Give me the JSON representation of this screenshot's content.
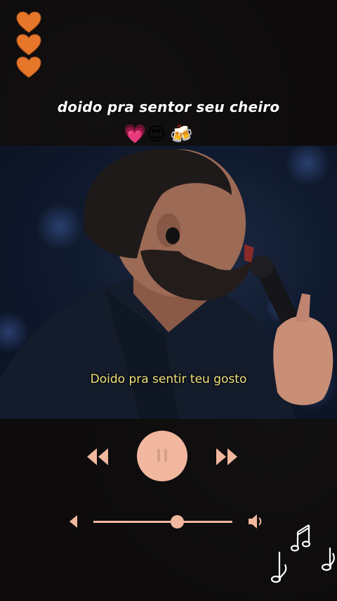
{
  "overlay": {
    "caption": "doido pra sentor seu cheiro",
    "emojis": [
      "💗",
      "😍",
      "🍻"
    ]
  },
  "video": {
    "subtitle": "Doido pra sentir teu gosto"
  },
  "player": {
    "state": "playing",
    "accent_color": "#f1b79f",
    "volume_level": 0.6,
    "icons": [
      "rewind-icon",
      "pause-icon",
      "fast-forward-icon",
      "volume-low-icon",
      "volume-high-icon"
    ]
  },
  "decor": {
    "heart_color": "#e87a2b",
    "icons": [
      "heart-icon",
      "heart-icon",
      "heart-icon",
      "music-notes-icon"
    ]
  }
}
